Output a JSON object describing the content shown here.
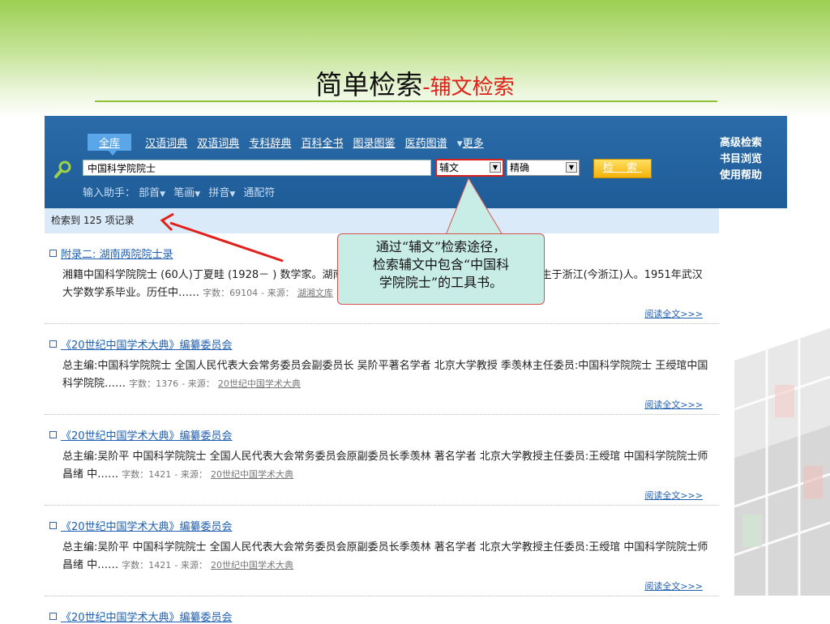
{
  "slide": {
    "title_main": "简单检索",
    "title_sub": "-辅文检索"
  },
  "search_panel": {
    "tabs": [
      {
        "label": "全库",
        "active": true
      },
      {
        "label": "汉语词典"
      },
      {
        "label": "双语词典"
      },
      {
        "label": "专科辞典"
      },
      {
        "label": "百科全书"
      },
      {
        "label": "图录图鉴"
      },
      {
        "label": "医药图谱"
      },
      {
        "label": "更多"
      }
    ],
    "query": "中国科学院院士",
    "field_select": "辅文",
    "mode_select": "精确",
    "search_button": "检 索",
    "helper_label": "输入助手：",
    "helper_items": [
      "部首",
      "笔画",
      "拼音",
      "通配符"
    ],
    "side_links": [
      "高级检索",
      "书目浏览",
      "使用帮助"
    ]
  },
  "results": {
    "count_text": "检索到 125 项记录",
    "read_more": "阅读全文>>>",
    "meta_words_label": "字数：",
    "meta_source_label": "- 来源：",
    "items": [
      {
        "title": "附录二: 湖南两院院士录",
        "body": "湘籍中国科学院院士 (60人)丁夏畦 (1928－ ) 数学家。湖南湘乡人。原籍江西新建(今南昌市新建区)，生于浙江(今浙江)人。1951年武汉大学数学系毕业。历任中……",
        "words": "69104",
        "source": "湖湘文库"
      },
      {
        "title": "《20世纪中国学术大典》编纂委员会",
        "body": "总主编:中国科学院院士 全国人民代表大会常务委员会副委员长 吴阶平著名学者 北京大学教授 季羡林主任委员:中国科学院院士 王绶琯中国科学院院……",
        "words": "1376",
        "source": "20世纪中国学术大典"
      },
      {
        "title": "《20世纪中国学术大典》编纂委员会",
        "body": "总主编:吴阶平 中国科学院院士 全国人民代表大会常务委员会原副委员长季羡林 著名学者 北京大学教授主任委员:王绶琯 中国科学院院士师昌绪 中……",
        "words": "1421",
        "source": "20世纪中国学术大典"
      },
      {
        "title": "《20世纪中国学术大典》编纂委员会",
        "body": "总主编:吴阶平 中国科学院院士 全国人民代表大会常务委员会原副委员长季羡林 著名学者 北京大学教授主任委员:王绶琯 中国科学院院士师昌绪 中……",
        "words": "1421",
        "source": "20世纪中国学术大典"
      },
      {
        "title": "《20世纪中国学术大典》编纂委员会"
      }
    ]
  },
  "callout": {
    "line1": "通过“辅文”检索途径，",
    "line2": "检索辅文中包含“中国科",
    "line3": "学院院士”的工具书。"
  },
  "colors": {
    "panel_blue": "#1e5c97",
    "accent_red": "#e0201a",
    "link_blue": "#1f5fae",
    "callout_bg": "#c8ece6"
  }
}
